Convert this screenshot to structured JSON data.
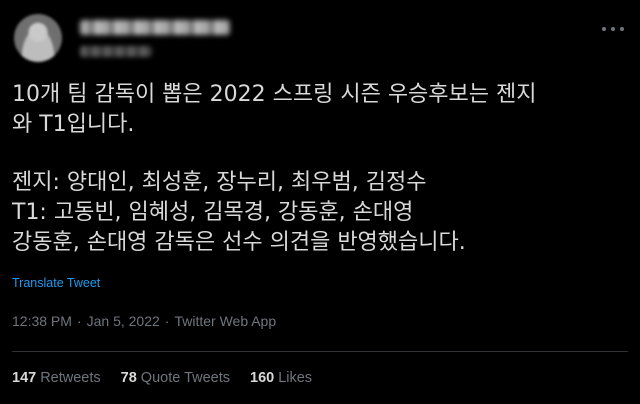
{
  "tweet": {
    "author": {
      "name": "",
      "handle": ""
    },
    "text_line_1": "10개 팀 감독이 뽑은 2022 스프링 시즌 우승후보는 젠지",
    "text_line_2": "와 T1입니다.",
    "text_line_3": "젠지: 양대인, 최성훈, 장누리, 최우범, 김정수",
    "text_line_4": "T1: 고동빈, 임혜성, 김목경, 강동훈, 손대영",
    "text_line_5": "강동훈, 손대영 감독은 선수 의견을 반영했습니다.",
    "translate_label": "Translate Tweet",
    "time": "12:38 PM",
    "date": "Jan 5, 2022",
    "source": "Twitter Web App",
    "separator": "·"
  },
  "stats": {
    "retweets_count": "147",
    "retweets_label": "Retweets",
    "quotes_count": "78",
    "quotes_label": "Quote Tweets",
    "likes_count": "160",
    "likes_label": "Likes"
  },
  "colors": {
    "background": "#000000",
    "text": "#d9d9d9",
    "muted": "#6e767d",
    "link": "#1d9bf0",
    "divider": "#2f3336"
  },
  "icons": {
    "more": "more-horizontal-icon"
  }
}
